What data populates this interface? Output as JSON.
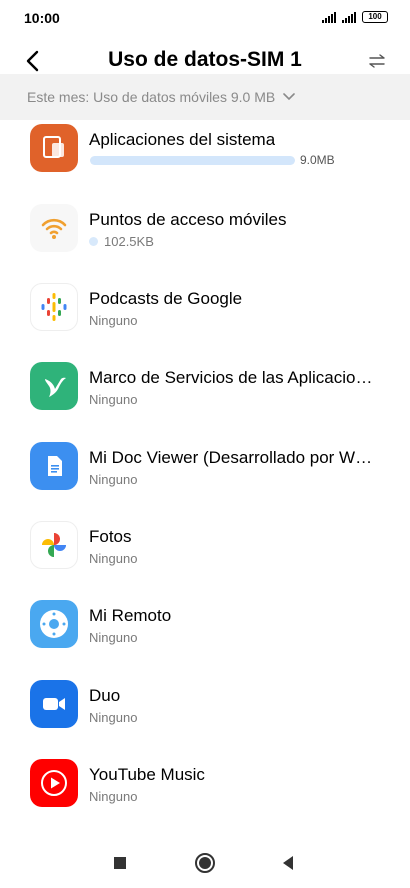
{
  "status_bar": {
    "time": "10:00",
    "battery": "100",
    "icons": [
      "signal-icon",
      "signal-icon",
      "battery-icon"
    ]
  },
  "header": {
    "title": "Uso de datos-SIM 1",
    "back_icon": "back-arrow-icon",
    "swap_icon": "swap-arrows-icon"
  },
  "filter": {
    "label": "Este mes: Uso de datos móviles 9.0 MB",
    "icon": "chevron-down-icon"
  },
  "apps": [
    {
      "name": "Aplicaciones del sistema",
      "usage": "9.0MB",
      "usage_fraction": 1.0,
      "icon": "system-apps-icon",
      "color": "#e0622a"
    },
    {
      "name": "Puntos de acceso móviles",
      "usage": "102.5KB",
      "icon": "hotspot-icon",
      "color": "#f0a030"
    },
    {
      "name": "Podcasts de Google",
      "usage": "Ninguno",
      "icon": "google-podcasts-icon"
    },
    {
      "name": "Marco de Servicios de las Aplicaciones",
      "usage": "Ninguno",
      "icon": "hummingbird-icon",
      "color": "#2fb37a"
    },
    {
      "name": "Mi Doc Viewer (Desarrollado por WPS Office)",
      "usage": "Ninguno",
      "icon": "doc-viewer-icon",
      "color": "#3c8ff0"
    },
    {
      "name": "Fotos",
      "usage": "Ninguno",
      "icon": "google-photos-icon"
    },
    {
      "name": "Mi Remoto",
      "usage": "Ninguno",
      "icon": "remote-icon",
      "color": "#4aa8f0"
    },
    {
      "name": "Duo",
      "usage": "Ninguno",
      "icon": "video-camera-icon",
      "color": "#1a73e8"
    },
    {
      "name": "YouTube Music",
      "usage": "Ninguno",
      "icon": "youtube-music-icon",
      "color": "#ff0000"
    }
  ],
  "nav": {
    "recent_icon": "square-icon",
    "home_icon": "circle-icon",
    "back_icon": "triangle-back-icon"
  }
}
